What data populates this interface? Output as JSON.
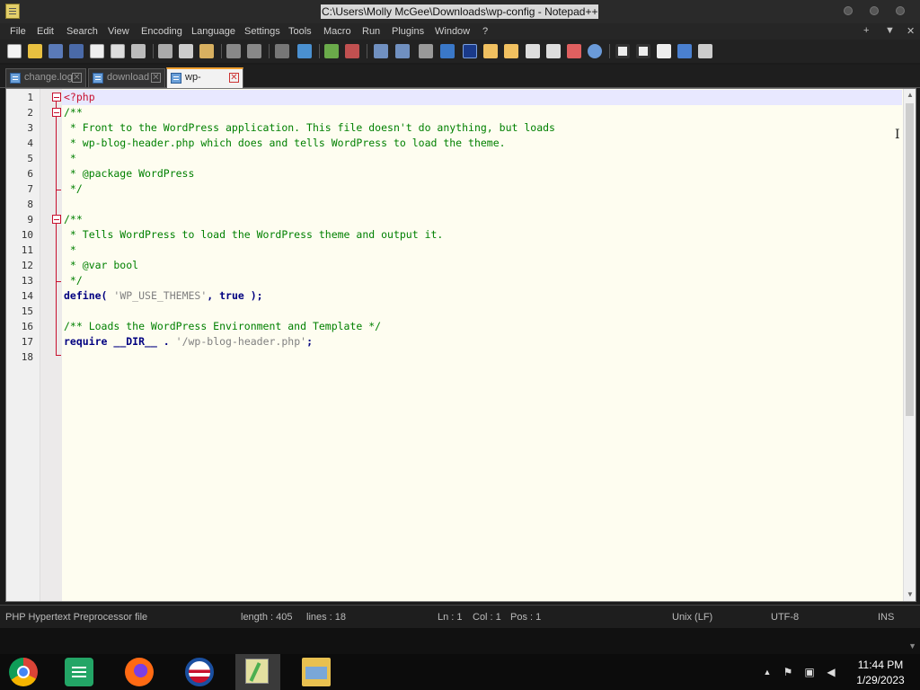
{
  "window": {
    "title": "C:\\Users\\Molly McGee\\Downloads\\wp-config - Notepad++"
  },
  "menu": {
    "items": [
      "File",
      "Edit",
      "Search",
      "View",
      "Encoding",
      "Language",
      "Settings",
      "Tools",
      "Macro",
      "Run",
      "Plugins",
      "Window",
      "?"
    ],
    "right_plus": "+",
    "right_arrow": "▼",
    "right_close": "✕"
  },
  "tabs": [
    {
      "label": "change.log",
      "active": false
    },
    {
      "label": "download",
      "active": false
    },
    {
      "label": "wp-config",
      "active": true
    }
  ],
  "editor": {
    "line_numbers": [
      "1",
      "2",
      "3",
      "4",
      "5",
      "6",
      "7",
      "8",
      "9",
      "10",
      "11",
      "12",
      "13",
      "14",
      "15",
      "16",
      "17",
      "18"
    ],
    "lines": [
      {
        "parts": [
          {
            "t": "<?php",
            "c": "php"
          }
        ]
      },
      {
        "parts": [
          {
            "t": "/**",
            "c": "c"
          }
        ]
      },
      {
        "parts": [
          {
            "t": " * Front to the WordPress application. This file doesn't do anything, but loads",
            "c": "c"
          }
        ]
      },
      {
        "parts": [
          {
            "t": " * wp-blog-header.php which does and tells WordPress to load the theme.",
            "c": "c"
          }
        ]
      },
      {
        "parts": [
          {
            "t": " *",
            "c": "c"
          }
        ]
      },
      {
        "parts": [
          {
            "t": " * @package WordPress",
            "c": "c"
          }
        ]
      },
      {
        "parts": [
          {
            "t": " */",
            "c": "c"
          }
        ]
      },
      {
        "parts": []
      },
      {
        "parts": [
          {
            "t": "/**",
            "c": "c"
          }
        ]
      },
      {
        "parts": [
          {
            "t": " * Tells WordPress to load the WordPress theme and output it.",
            "c": "c"
          }
        ]
      },
      {
        "parts": [
          {
            "t": " *",
            "c": "c"
          }
        ]
      },
      {
        "parts": [
          {
            "t": " * @var bool",
            "c": "c"
          }
        ]
      },
      {
        "parts": [
          {
            "t": " */",
            "c": "c"
          }
        ]
      },
      {
        "parts": [
          {
            "t": "define",
            "c": "kw"
          },
          {
            "t": "( ",
            "c": "op"
          },
          {
            "t": "'WP_USE_THEMES'",
            "c": "str"
          },
          {
            "t": ", ",
            "c": "op"
          },
          {
            "t": "true",
            "c": "kw"
          },
          {
            "t": " );",
            "c": "op"
          }
        ]
      },
      {
        "parts": []
      },
      {
        "parts": [
          {
            "t": "/** Loads the WordPress Environment and Template */",
            "c": "c"
          }
        ]
      },
      {
        "parts": [
          {
            "t": "require",
            "c": "kw"
          },
          {
            "t": " ",
            "c": ""
          },
          {
            "t": "__DIR__",
            "c": "kw"
          },
          {
            "t": " . ",
            "c": "op"
          },
          {
            "t": "'/wp-blog-header.php'",
            "c": "str"
          },
          {
            "t": ";",
            "c": "op"
          }
        ]
      },
      {
        "parts": []
      }
    ]
  },
  "status": {
    "file_type": "PHP Hypertext Preprocessor file",
    "length": "length : 405",
    "lines": "lines : 18",
    "ln": "Ln : 1",
    "col": "Col : 1",
    "pos": "Pos : 1",
    "eol": "Unix (LF)",
    "encoding": "UTF-8",
    "mode": "INS"
  },
  "taskbar": {
    "apps": [
      "chrome-icon",
      "sheets-icon",
      "firefox-icon",
      "obama-logo-icon",
      "notepadpp-icon",
      "file-explorer-icon"
    ],
    "time": "11:44 PM",
    "date": "1/29/2023"
  },
  "colors": {
    "comment": "#008000",
    "keyword": "#000080",
    "string": "#808080",
    "php_tag": "#c8102e",
    "editor_bg": "#fefdf0",
    "current_line": "#e8e8ff",
    "active_tab_accent": "#f0a030"
  }
}
